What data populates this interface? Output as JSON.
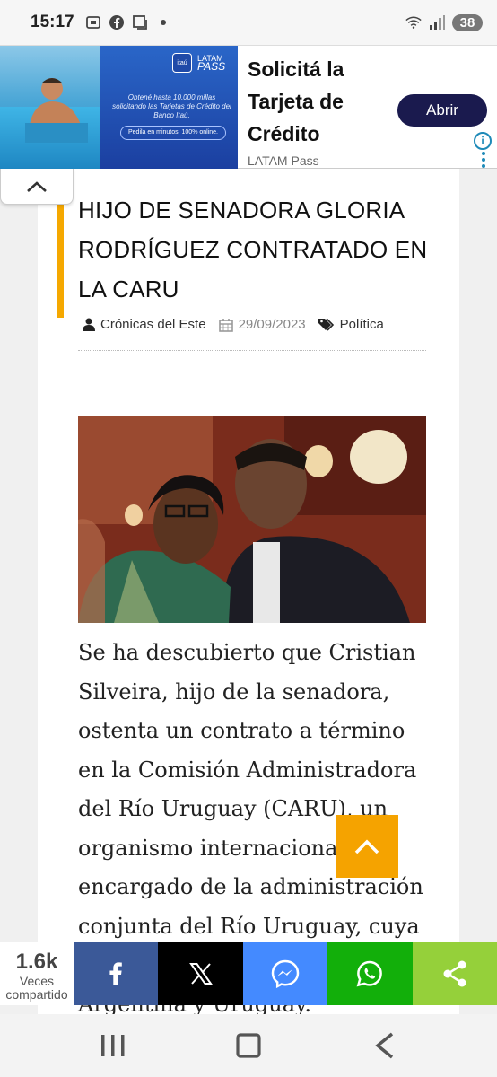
{
  "status_bar": {
    "time": "15:17",
    "battery": "38"
  },
  "ad": {
    "title": "Solicitá la Tarjeta de Crédito",
    "source": "LATAM Pass",
    "cta": "Abrir",
    "itau": "itaú",
    "latam_top": "LATAM",
    "latam_bottom": "PASS",
    "panel_text": "Obtené hasta 10.000 millas solicitando las Tarjetas de Crédito del Banco Itaú.",
    "pill_text": "Pedila en minutos, 100% online.",
    "info": "i"
  },
  "article": {
    "title": "HIJO DE SENADORA GLORIA RODRÍGUEZ CONTRATADO EN LA CARU",
    "author": "Crónicas del Este",
    "date": "29/09/2023",
    "category": "Política",
    "body": "Se ha descubierto que Cristian Silveira, hijo de la senadora, ostenta un contrato a término en la Comisión Administradora del Río Uruguay (CARU), un organismo internacional encargado de la administración conjunta del Río Uruguay, cuya jurisdicción es compartida entre Argentina y Uruguay."
  },
  "share": {
    "count": "1.6k",
    "label_1": "Veces",
    "label_2": "compartido",
    "colors": {
      "facebook": "#3b5998",
      "x": "#000000",
      "messenger": "#448aff",
      "whatsapp": "#12af0a",
      "share": "#95d03a"
    }
  },
  "colors": {
    "accent": "#f5a800",
    "scroll_top": "#f5a300",
    "ad_cta": "#1a1a4e"
  }
}
